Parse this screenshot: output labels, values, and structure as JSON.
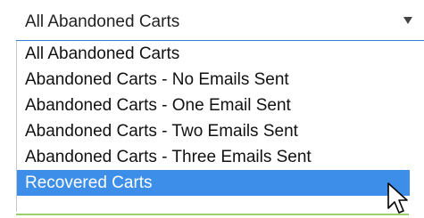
{
  "select": {
    "value": "All Abandoned Carts"
  },
  "options": [
    {
      "label": "All Abandoned Carts",
      "selected": false
    },
    {
      "label": "Abandoned Carts - No Emails Sent",
      "selected": false
    },
    {
      "label": "Abandoned Carts - One Email Sent",
      "selected": false
    },
    {
      "label": "Abandoned Carts - Two Emails Sent",
      "selected": false
    },
    {
      "label": "Abandoned Carts - Three Emails Sent",
      "selected": false
    },
    {
      "label": "Recovered Carts",
      "selected": true
    }
  ],
  "colors": {
    "highlight": "#3d8ee8",
    "focus_border": "#2a7fd6"
  },
  "icons": {
    "arrow": "chevron-down-icon",
    "cursor": "mouse-pointer-icon"
  }
}
